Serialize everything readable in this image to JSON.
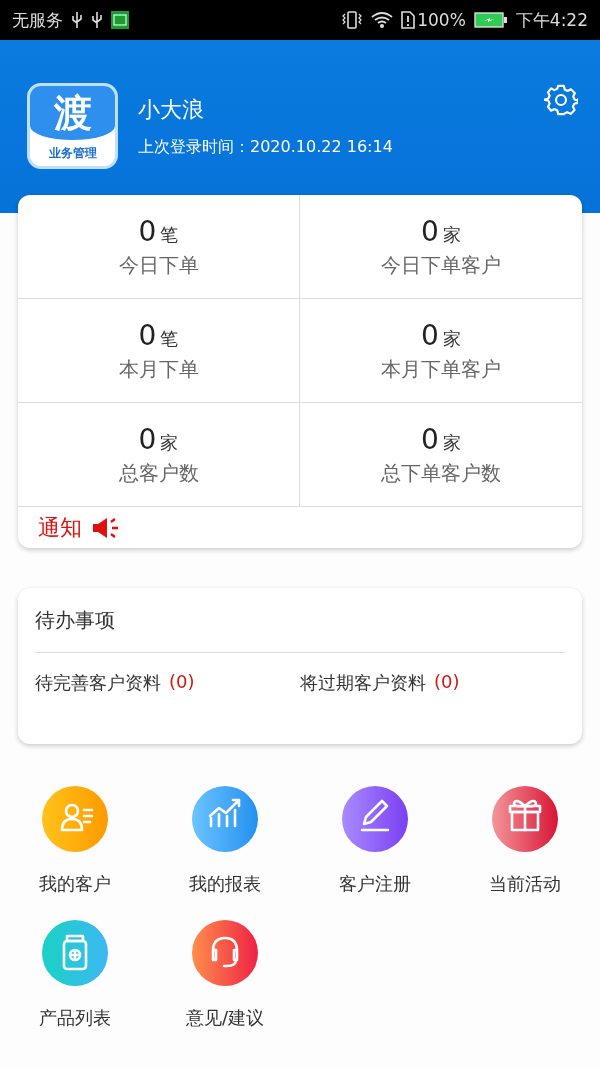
{
  "status_bar": {
    "carrier": "无服务",
    "battery": "100%",
    "time": "下午4:22"
  },
  "header": {
    "logo_main": "渡",
    "logo_sub": "业务管理",
    "user_name": "小大浪",
    "last_login": "上次登录时间：2020.10.22 16:14"
  },
  "stats": [
    {
      "value": "0",
      "unit": "笔",
      "label": "今日下单"
    },
    {
      "value": "0",
      "unit": "家",
      "label": "今日下单客户"
    },
    {
      "value": "0",
      "unit": "笔",
      "label": "本月下单"
    },
    {
      "value": "0",
      "unit": "家",
      "label": "本月下单客户"
    },
    {
      "value": "0",
      "unit": "家",
      "label": "总客户数"
    },
    {
      "value": "0",
      "unit": "家",
      "label": "总下单客户数"
    }
  ],
  "notice": {
    "label": "通知"
  },
  "todo": {
    "title": "待办事项",
    "items": [
      {
        "label": "待完善客户资料",
        "count": "(0)"
      },
      {
        "label": "将过期客户资料",
        "count": "(0)"
      }
    ]
  },
  "menu": [
    {
      "kind": "customer",
      "label": "我的客户"
    },
    {
      "kind": "report",
      "label": "我的报表"
    },
    {
      "kind": "register",
      "label": "客户注册"
    },
    {
      "kind": "gift",
      "label": "当前活动"
    },
    {
      "kind": "product",
      "label": "产品列表"
    },
    {
      "kind": "feedback",
      "label": "意见/建议"
    }
  ]
}
